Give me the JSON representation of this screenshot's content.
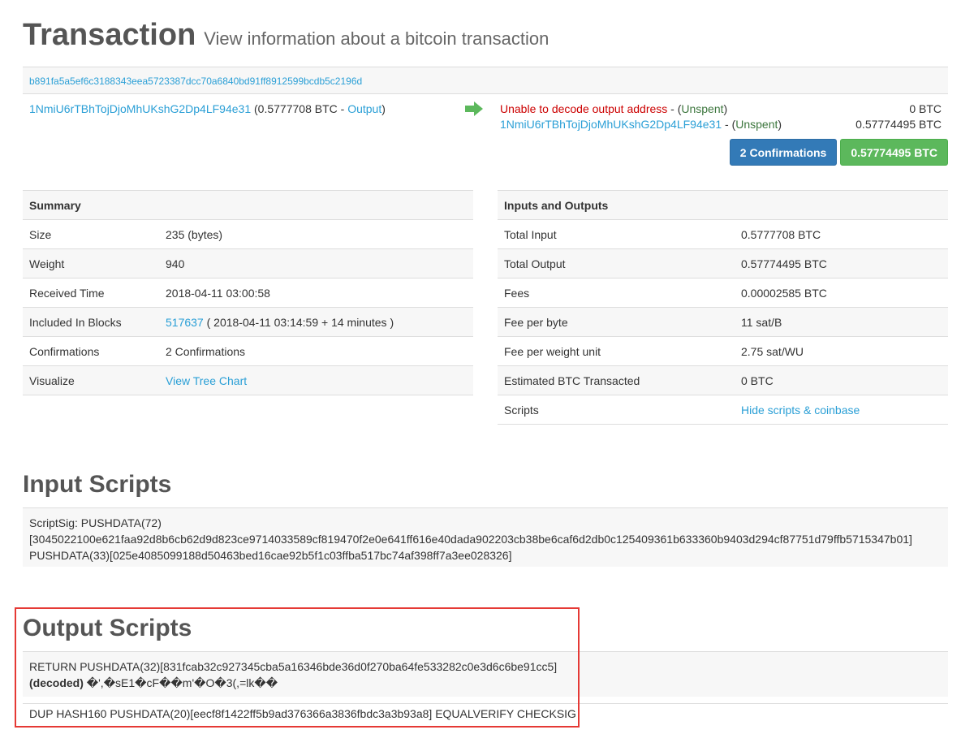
{
  "header": {
    "title": "Transaction",
    "subtitle": "View information about a bitcoin transaction"
  },
  "tx": {
    "hash": "b891fa5a5ef6c3188343eea5723387dcc70a6840bd91ff8912599bcdb5c2196d"
  },
  "inputs": [
    {
      "address": "1NmiU6rTBhTojDjoMhUKshG2Dp4LF94e31",
      "amount_prefix": " (0.5777708 BTC - ",
      "link": "Output",
      "amount_suffix": ")"
    }
  ],
  "outputs": [
    {
      "label": "Unable to decode output address",
      "sep": " - (",
      "status": "Unspent",
      "close": ")",
      "amount": "0 BTC"
    },
    {
      "label": "1NmiU6rTBhTojDjoMhUKshG2Dp4LF94e31",
      "sep": " - (",
      "status": "Unspent",
      "close": ")",
      "amount": "0.57774495 BTC"
    }
  ],
  "buttons": {
    "confirmations": "2 Confirmations",
    "total": "0.57774495 BTC"
  },
  "summary": {
    "heading": "Summary",
    "size_k": "Size",
    "size_v": "235 (bytes)",
    "weight_k": "Weight",
    "weight_v": "940",
    "received_k": "Received Time",
    "received_v": "2018-04-11 03:00:58",
    "blocks_k": "Included In Blocks",
    "blocks_link": "517637",
    "blocks_rest": " ( 2018-04-11 03:14:59 + 14 minutes )",
    "conf_k": "Confirmations",
    "conf_v": "2 Confirmations",
    "vis_k": "Visualize",
    "vis_link": "View Tree Chart"
  },
  "io": {
    "heading": "Inputs and Outputs",
    "ti_k": "Total Input",
    "ti_v": "0.5777708 BTC",
    "to_k": "Total Output",
    "to_v": "0.57774495 BTC",
    "fees_k": "Fees",
    "fees_v": "0.00002585 BTC",
    "fpb_k": "Fee per byte",
    "fpb_v": "11 sat/B",
    "fpw_k": "Fee per weight unit",
    "fpw_v": "2.75 sat/WU",
    "est_k": "Estimated BTC Transacted",
    "est_v": "0 BTC",
    "scripts_k": "Scripts",
    "scripts_link": "Hide scripts & coinbase"
  },
  "input_scripts": {
    "heading": "Input Scripts",
    "line1": "ScriptSig: PUSHDATA(72)",
    "line2": "[3045022100e621faa92d8b6cb62d9d823ce9714033589cf819470f2e0e641ff616e40dada902203cb38be6caf6d2db0c125409361b633360b9403d294cf87751d79ffb5715347b01]",
    "line3": "PUSHDATA(33)[025e4085099188d50463bed16cae92b5f1c03ffba517bc74af398ff7a3ee028326]"
  },
  "output_scripts": {
    "heading": "Output Scripts",
    "line1": "RETURN PUSHDATA(32)[831fcab32c927345cba5a16346bde36d0f270ba64fe533282c0e3d6c6be91cc5]",
    "decoded_label": "(decoded)",
    "decoded_value": " �',�sE1�cF��m'�O�3(,=lk��",
    "line2": "DUP HASH160 PUSHDATA(20)[eecf8f1422ff5b9ad376366a3836fbdc3a3b93a8] EQUALVERIFY CHECKSIG"
  },
  "colors": {
    "link": "#2a9fd6",
    "unable": "#cc0000",
    "unspent": "#3c763d",
    "confirm_btn": "#337ab7",
    "amount_btn": "#5cb85c",
    "highlight": "#e53935"
  },
  "icons": {
    "arrow": "right-arrow-icon"
  }
}
